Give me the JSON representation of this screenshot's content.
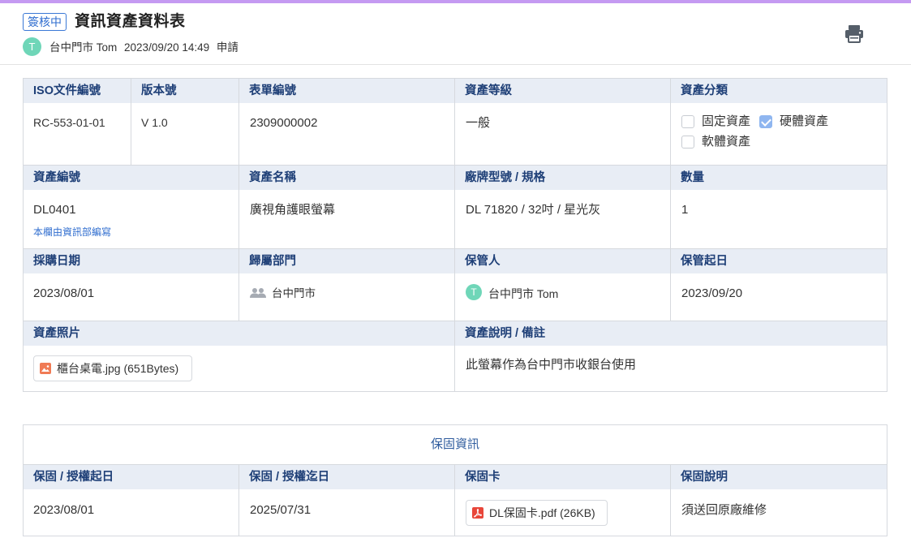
{
  "header": {
    "status": "簽核中",
    "title": "資訊資產資料表",
    "applicant_avatar": "T",
    "applicant_name": "台中門市 Tom",
    "timestamp": "2023/09/20 14:49",
    "action": "申請",
    "print_icon": "printer-icon"
  },
  "main": {
    "iso_label": "ISO文件編號",
    "iso_value": "RC-553-01-01",
    "version_label": "版本號",
    "version_value": "V 1.0",
    "form_no_label": "表單編號",
    "form_no_value": "2309000002",
    "level_label": "資產等級",
    "level_value": "一般",
    "category_label": "資產分類",
    "category_options": [
      {
        "label": "固定資產",
        "checked": false
      },
      {
        "label": "硬體資產",
        "checked": true
      },
      {
        "label": "軟體資產",
        "checked": false
      }
    ],
    "asset_no_label": "資產編號",
    "asset_no_value": "DL0401",
    "asset_no_note": "本欄由資訊部編寫",
    "asset_name_label": "資產名稱",
    "asset_name_value": "廣視角護眼螢幕",
    "model_label": "廠牌型號 / 規格",
    "model_value": "DL 71820 / 32吋 / 星光灰",
    "qty_label": "數量",
    "qty_value": "1",
    "purchase_label": "採購日期",
    "purchase_value": "2023/08/01",
    "dept_label": "歸屬部門",
    "dept_value": "台中門市",
    "custodian_label": "保管人",
    "custodian_avatar": "T",
    "custodian_value": "台中門市 Tom",
    "custody_start_label": "保管起日",
    "custody_start_value": "2023/09/20",
    "photo_label": "資產照片",
    "photo_file": "櫃台桌電.jpg (651Bytes)",
    "remark_label": "資產說明 / 備註",
    "remark_value": "此螢幕作為台中門市收銀台使用"
  },
  "warranty": {
    "section_title": "保固資訊",
    "start_label": "保固 / 授權起日",
    "start_value": "2023/08/01",
    "end_label": "保固 / 授權迄日",
    "end_value": "2025/07/31",
    "card_label": "保固卡",
    "card_file": "DL保固卡.pdf (26KB)",
    "desc_label": "保固說明",
    "desc_value": "須送回原廠維修"
  }
}
